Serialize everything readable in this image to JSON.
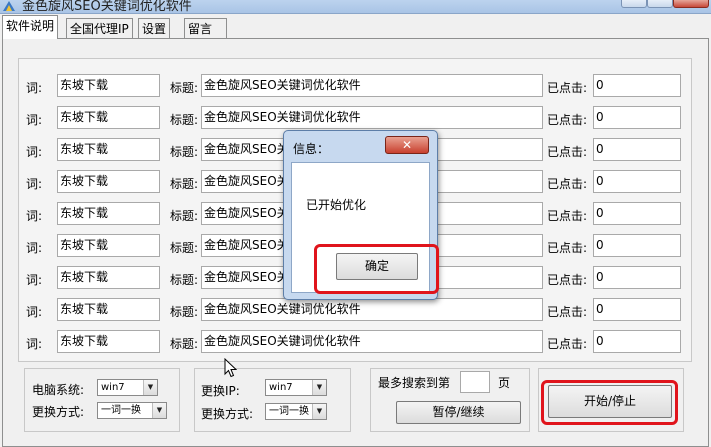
{
  "window": {
    "title": "金色旋风SEO关键词优化软件"
  },
  "tabs": [
    "软件说明",
    "全国代理IP",
    "设置",
    "留言"
  ],
  "row_labels": {
    "word": "词:",
    "title": "标题:",
    "clicked": "已点击:"
  },
  "rows": [
    {
      "word": "东坡下载",
      "title": "金色旋风SEO关键词优化软件",
      "clicked": "0"
    },
    {
      "word": "东坡下载",
      "title": "金色旋风SEO关键词优化软件",
      "clicked": "0"
    },
    {
      "word": "东坡下载",
      "title": "金色旋风SEO关键词优化软件",
      "clicked": "0"
    },
    {
      "word": "东坡下载",
      "title": "金色旋风SEO关键词优化软件",
      "clicked": "0"
    },
    {
      "word": "东坡下载",
      "title": "金色旋风SEO关键词优化软件",
      "clicked": "0"
    },
    {
      "word": "东坡下载",
      "title": "金色旋风SEO关键词优化软件",
      "clicked": "0"
    },
    {
      "word": "东坡下载",
      "title": "金色旋风SEO关键词优化软件",
      "clicked": "0"
    },
    {
      "word": "东坡下载",
      "title": "金色旋风SEO关键词优化软件",
      "clicked": "0"
    },
    {
      "word": "东坡下载",
      "title": "金色旋风SEO关键词优化软件",
      "clicked": "0"
    }
  ],
  "computer_group": {
    "system_label": "电脑系统:",
    "system_value": "win7",
    "method_label": "更换方式:",
    "method_value": "一词一换"
  },
  "ip_group": {
    "ip_label": "更换IP:",
    "ip_value": "win7",
    "method_label": "更换方式:",
    "method_value": "一词一换"
  },
  "search_group": {
    "max_label": "最多搜索到第",
    "page_value": "",
    "page_suffix": "页",
    "pause_button": "暂停/继续"
  },
  "start_button": "开始/停止",
  "dialog": {
    "title": "信息：",
    "message": "已开始优化",
    "ok_button": "确定"
  },
  "icons": {
    "app": "app-logo-icon",
    "cursor": "mouse-cursor-icon"
  },
  "colors": {
    "highlight": "#e0141c",
    "dialog_frame": "#c7d9ef"
  }
}
